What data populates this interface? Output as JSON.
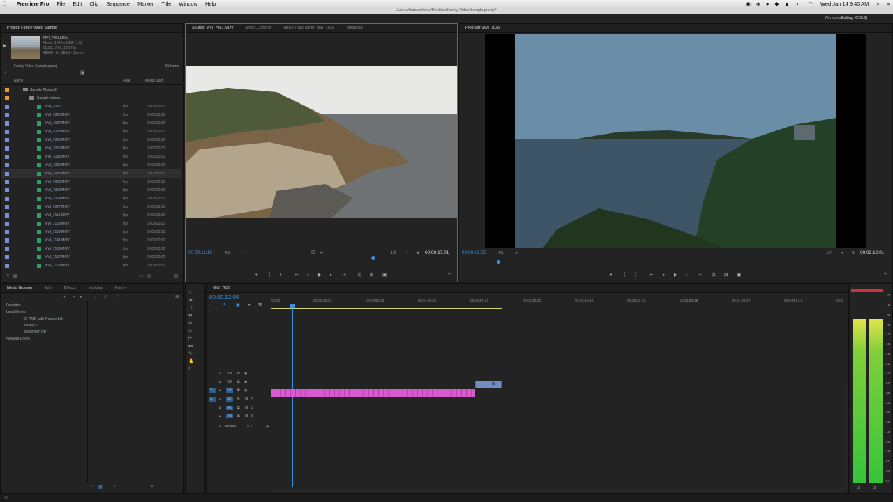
{
  "menubar": {
    "app": "Premiere Pro",
    "items": [
      "File",
      "Edit",
      "Clip",
      "Sequence",
      "Marker",
      "Title",
      "Window",
      "Help"
    ],
    "clock": "Wed Jan 14  9:40 AM"
  },
  "titlebar": {
    "path": "/Users/dariusw/here/Desktop/Family Video Sample.prproj *"
  },
  "workspace": {
    "label": "Workspace:",
    "value": "Editing (CS5.5)"
  },
  "project": {
    "tab": "Project: Family Video Sample",
    "clip_name": "MVI_7051.MOV",
    "clip_info": [
      "Movie, 1920 x 1080 (1.0)",
      "00;00;17;01, 23.976p",
      "48000 Hz - 16-bit - Stereo"
    ],
    "file": "Family Video Sample.prproj",
    "item_count": "81 Items",
    "columns": [
      "Name",
      "Rate",
      "Media Start"
    ],
    "folders": [
      "Sample Photos 2",
      "Sample Videos"
    ],
    "items": [
      {
        "name": "MVI_7026",
        "rate": "fps",
        "start": "00:00:00:00"
      },
      {
        "name": "MVI_7026.MOV",
        "rate": "fps",
        "start": "00:00:00:00"
      },
      {
        "name": "MVI_7027.MOV",
        "rate": "fps",
        "start": "00:00:00:00"
      },
      {
        "name": "MVI_7028.MOV",
        "rate": "fps",
        "start": "00:00:00:00"
      },
      {
        "name": "MVI_7029.MOV",
        "rate": "fps",
        "start": "00:00:00:00"
      },
      {
        "name": "MVI_7030.MOV",
        "rate": "fps",
        "start": "00:00:00:00"
      },
      {
        "name": "MVI_7031.MOV",
        "rate": "fps",
        "start": "00:00:00:00"
      },
      {
        "name": "MVI_7032.MOV",
        "rate": "fps",
        "start": "00:00:00:00"
      },
      {
        "name": "MVI_7051.MOV",
        "rate": "fps",
        "start": "00:00:00:00"
      },
      {
        "name": "MVI_7052.MOV",
        "rate": "fps",
        "start": "00:00:00:00"
      },
      {
        "name": "MVI_7053.MOV",
        "rate": "fps",
        "start": "00:00:00:00"
      },
      {
        "name": "MVI_7069.MOV",
        "rate": "fps",
        "start": "00:00:00:00"
      },
      {
        "name": "MVI_7077.MOV",
        "rate": "fps",
        "start": "00:00:00:00"
      },
      {
        "name": "MVI_7116.MOV",
        "rate": "fps",
        "start": "00:00:00:00"
      },
      {
        "name": "MVI_7128.MOV",
        "rate": "fps",
        "start": "00:00:00:00"
      },
      {
        "name": "MVI_7129.MOV",
        "rate": "fps",
        "start": "00:00:00:00"
      },
      {
        "name": "MVI_7141.MOV",
        "rate": "fps",
        "start": "00:00:00:00"
      },
      {
        "name": "MVI_7166.MOV",
        "rate": "fps",
        "start": "00:00:00:00"
      },
      {
        "name": "MVI_7167.MOV",
        "rate": "fps",
        "start": "00:00:00:00"
      },
      {
        "name": "MVI_7168.MOV",
        "rate": "fps",
        "start": "00:00:00:00"
      }
    ]
  },
  "source": {
    "tabs": [
      "Source: MVI_7051.MOV",
      "Effect Controls",
      "Audio Track Mixer: MVI_7026",
      "Metadata"
    ],
    "timecode": "00:00:11:10",
    "fit": "Fit",
    "resolution": "1/2",
    "duration": "00:00:17:01"
  },
  "program": {
    "tab": "Program: MVI_7026",
    "timecode": "00:00:12:05",
    "fit": "Fit",
    "resolution": "1/2",
    "duration": "00:02:12:01"
  },
  "browser": {
    "tabs": [
      "Media Browser",
      "Info",
      "Effects",
      "Markers",
      "History"
    ],
    "tree": [
      "Favorites",
      "Local Drives",
      "G-RAID with Thunderbolt",
      "If Only 1",
      "Macintosh HD",
      "Network Drives"
    ]
  },
  "timeline": {
    "tab": "MVI_7026",
    "timecode": "00:00:12:05",
    "ruler": [
      "00:00",
      "00:00:29:23",
      "00:00:59:22",
      "00:01:29:21",
      "00:01:59:21",
      "00:02:29:20",
      "00:02:59:19",
      "00:03:29:18",
      "00:03:59:18",
      "00:04:29:17",
      "00:04:59:16",
      "00:0"
    ],
    "tracks": {
      "video": [
        "V3",
        "V2",
        "V1"
      ],
      "audio": [
        "A1",
        "A2",
        "A3"
      ],
      "master": "Master",
      "master_value": "0.0",
      "mute": "M",
      "solo": "S"
    }
  },
  "meter": {
    "scale": [
      "0",
      "-3",
      "-6",
      "-9",
      "-12",
      "-15",
      "-18",
      "-21",
      "-24",
      "-27",
      "-30",
      "-33",
      "-36",
      "-39",
      "-42",
      "-45",
      "-48",
      "-51",
      "-54",
      "-57"
    ],
    "channels": [
      "S",
      "S"
    ]
  }
}
